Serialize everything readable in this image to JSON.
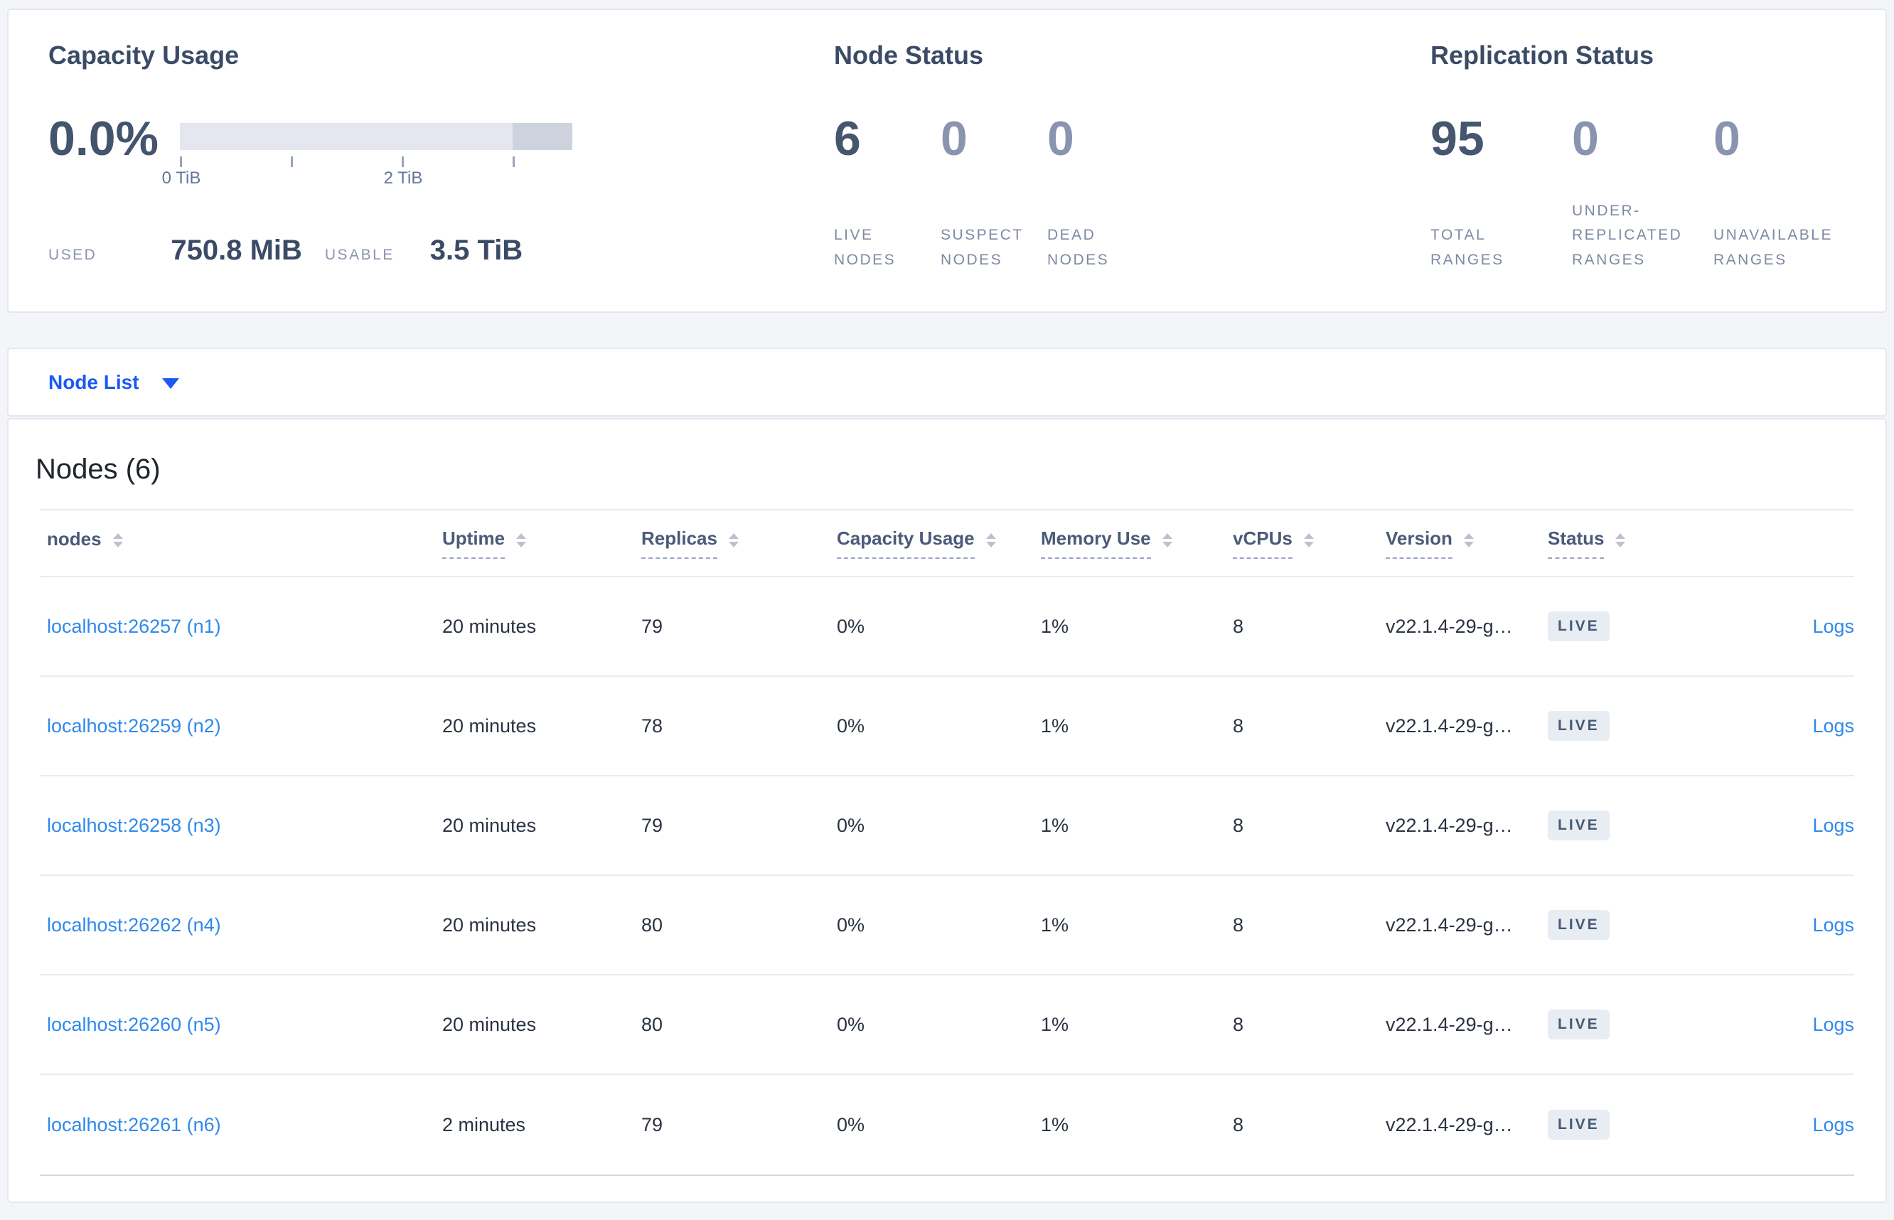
{
  "overview": {
    "capacity": {
      "title": "Capacity Usage",
      "percent": "0.0%",
      "axis_ticks": [
        "0 TiB",
        "2 TiB"
      ],
      "used_label": "USED",
      "used_value": "750.8 MiB",
      "usable_label": "USABLE",
      "usable_value": "3.5 TiB"
    },
    "node_status": {
      "title": "Node Status",
      "stats": [
        {
          "value": "6",
          "label": "LIVE\nNODES"
        },
        {
          "value": "0",
          "label": "SUSPECT\nNODES"
        },
        {
          "value": "0",
          "label": "DEAD\nNODES"
        }
      ]
    },
    "replication": {
      "title": "Replication Status",
      "stats": [
        {
          "value": "95",
          "label": "TOTAL\nRANGES"
        },
        {
          "value": "0",
          "label": "UNDER-\nREPLICATED\nRANGES"
        },
        {
          "value": "0",
          "label": "UNAVAILABLE\nRANGES"
        }
      ]
    }
  },
  "node_list": {
    "dropdown_label": "Node List"
  },
  "table": {
    "heading": "Nodes (6)",
    "columns": [
      {
        "label": "nodes"
      },
      {
        "label": "Uptime"
      },
      {
        "label": "Replicas"
      },
      {
        "label": "Capacity Usage"
      },
      {
        "label": "Memory Use"
      },
      {
        "label": "vCPUs"
      },
      {
        "label": "Version"
      },
      {
        "label": "Status"
      }
    ],
    "rows": [
      {
        "node": "localhost:26257 (n1)",
        "uptime": "20 minutes",
        "replicas": "79",
        "capacity": "0%",
        "memory": "1%",
        "vcpus": "8",
        "version": "v22.1.4-29-g…",
        "status": "LIVE",
        "logs": "Logs"
      },
      {
        "node": "localhost:26259 (n2)",
        "uptime": "20 minutes",
        "replicas": "78",
        "capacity": "0%",
        "memory": "1%",
        "vcpus": "8",
        "version": "v22.1.4-29-g…",
        "status": "LIVE",
        "logs": "Logs"
      },
      {
        "node": "localhost:26258 (n3)",
        "uptime": "20 minutes",
        "replicas": "79",
        "capacity": "0%",
        "memory": "1%",
        "vcpus": "8",
        "version": "v22.1.4-29-g…",
        "status": "LIVE",
        "logs": "Logs"
      },
      {
        "node": "localhost:26262 (n4)",
        "uptime": "20 minutes",
        "replicas": "80",
        "capacity": "0%",
        "memory": "1%",
        "vcpus": "8",
        "version": "v22.1.4-29-g…",
        "status": "LIVE",
        "logs": "Logs"
      },
      {
        "node": "localhost:26260 (n5)",
        "uptime": "20 minutes",
        "replicas": "80",
        "capacity": "0%",
        "memory": "1%",
        "vcpus": "8",
        "version": "v22.1.4-29-g…",
        "status": "LIVE",
        "logs": "Logs"
      },
      {
        "node": "localhost:26261 (n6)",
        "uptime": "2 minutes",
        "replicas": "79",
        "capacity": "0%",
        "memory": "1%",
        "vcpus": "8",
        "version": "v22.1.4-29-g…",
        "status": "LIVE",
        "logs": "Logs"
      }
    ]
  },
  "colors": {
    "primary_blue": "#1b59f2",
    "link_blue": "#2f89ec",
    "stat_primary": "#46566f",
    "stat_secondary": "#8a94b0",
    "badge_bg": "#e8ecf3",
    "page_bg": "#f4f5f9"
  }
}
